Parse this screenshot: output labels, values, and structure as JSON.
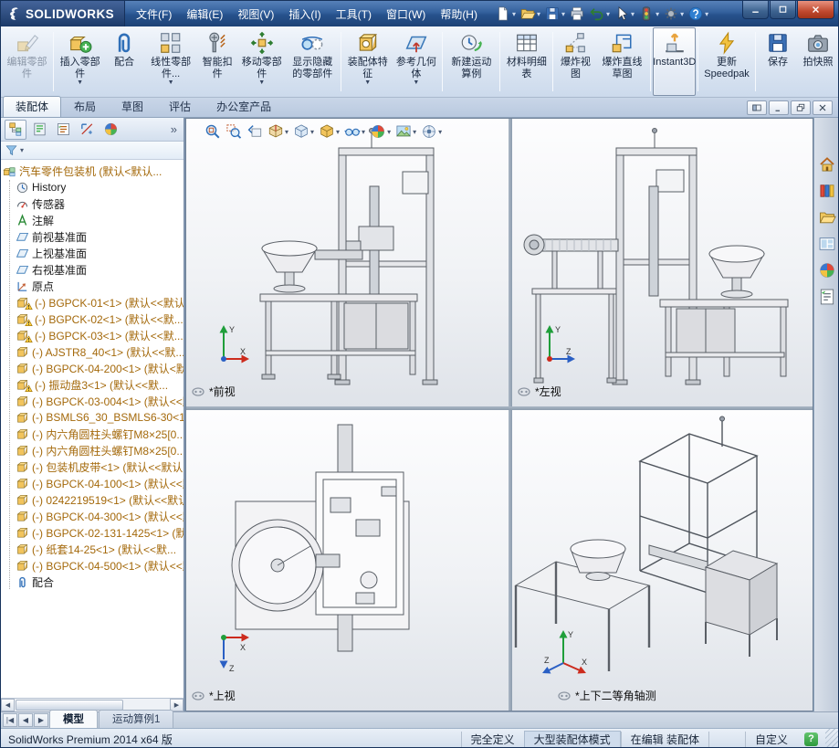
{
  "colors": {
    "titlebar_blue": "#2f5b99",
    "ribbon_background": "#d9e4f3",
    "component_text_orange": "#a4690b",
    "warning_yellow": "#ffd23e",
    "status_green": "#2e9a3c"
  },
  "titlebar": {
    "logo_text": "SOLIDWORKS",
    "menus": [
      "文件(F)",
      "编辑(E)",
      "视图(V)",
      "插入(I)",
      "工具(T)",
      "窗口(W)",
      "帮助(H)"
    ],
    "quick_access": [
      {
        "name": "new-document",
        "icon": "new-doc",
        "dropdown": true
      },
      {
        "name": "open-document",
        "icon": "open",
        "dropdown": true
      },
      {
        "name": "save-document",
        "icon": "save",
        "dropdown": true
      },
      {
        "name": "print-document",
        "icon": "print",
        "dropdown": false
      },
      {
        "name": "undo",
        "icon": "undo",
        "dropdown": true
      },
      {
        "name": "select-tool",
        "icon": "select-cursor",
        "dropdown": true
      },
      {
        "name": "rebuild",
        "icon": "rebuild",
        "dropdown": true
      },
      {
        "name": "options",
        "icon": "options",
        "dropdown": true
      },
      {
        "name": "help",
        "icon": "help",
        "dropdown": true
      }
    ],
    "window_buttons": [
      {
        "name": "minimize-window",
        "icon": "tb-min"
      },
      {
        "name": "maximize-window",
        "icon": "tb-max"
      },
      {
        "name": "close-window",
        "icon": "tb-close"
      }
    ]
  },
  "ribbon": {
    "buttons": [
      {
        "name": "edit-component-button",
        "icon": "edit-component",
        "label": "编辑零部件",
        "disabled": true,
        "sep": true
      },
      {
        "name": "insert-component-button",
        "icon": "insert-component",
        "label": "插入零部件",
        "dropdown": true
      },
      {
        "name": "mate-button",
        "icon": "mate",
        "label": "配合"
      },
      {
        "name": "linear-component-pattern-button",
        "icon": "linear-pattern",
        "label": "线性零部件...",
        "dropdown": true
      },
      {
        "name": "smart-fasteners-button",
        "icon": "smart-fastener",
        "label": "智能扣件"
      },
      {
        "name": "move-component-button",
        "icon": "move-component",
        "label": "移动零部件",
        "dropdown": true
      },
      {
        "name": "show-hidden-components-button",
        "icon": "show-hidden",
        "label": "显示隐藏的零部件",
        "sep": true
      },
      {
        "name": "assembly-features-button",
        "icon": "assembly-features",
        "label": "装配体特征",
        "dropdown": true
      },
      {
        "name": "reference-geometry-button",
        "icon": "reference-geometry",
        "label": "参考几何体",
        "dropdown": true,
        "sep": true
      },
      {
        "name": "new-motion-study-button",
        "icon": "motion-study",
        "label": "新建运动算例",
        "sep": true
      },
      {
        "name": "bill-of-materials-button",
        "icon": "bom",
        "label": "材料明细表",
        "sep": true
      },
      {
        "name": "exploded-view-button",
        "icon": "exploded-view",
        "label": "爆炸视图"
      },
      {
        "name": "explode-line-sketch-button",
        "icon": "explode-sketch",
        "label": "爆炸直线草图",
        "sep": true
      },
      {
        "name": "instant3d-button",
        "icon": "instant3d",
        "label": "Instant3D",
        "active": true,
        "sep": true
      },
      {
        "name": "update-speedpak-button",
        "icon": "speedpak",
        "label": "更新 Speedpak",
        "sep": true
      },
      {
        "name": "save-button",
        "icon": "save-small",
        "label": "保存"
      },
      {
        "name": "take-snapshot-button",
        "icon": "snapshot",
        "label": "拍快照"
      }
    ],
    "tabs": [
      {
        "label": "装配体",
        "active": true
      },
      {
        "label": "布局",
        "active": false
      },
      {
        "label": "草图",
        "active": false
      },
      {
        "label": "评估",
        "active": false
      },
      {
        "label": "办公室产品",
        "active": false
      }
    ]
  },
  "document_window_buttons": [
    {
      "name": "cascade-document-button",
      "icon": "win-prev"
    },
    {
      "name": "minimize-document-button",
      "icon": "win-min"
    },
    {
      "name": "restore-document-button",
      "icon": "win-restore"
    },
    {
      "name": "close-document-button",
      "icon": "win-close"
    }
  ],
  "feature_panel": {
    "overflow_chevron": "»",
    "tabs": [
      {
        "name": "featuremanager-tab",
        "icon": "fm-tree",
        "active": true
      },
      {
        "name": "propertymanager-tab",
        "icon": "pm",
        "active": false
      },
      {
        "name": "configurationmanager-tab",
        "icon": "cfg",
        "active": false
      },
      {
        "name": "dimxpertmanager-tab",
        "icon": "dim",
        "active": false
      },
      {
        "name": "displaymanager-tab",
        "icon": "disp",
        "active": false
      }
    ],
    "tree_items": [
      {
        "icon": "assembly",
        "label": "汽车零件包装机 (默认<默认...",
        "orange": true,
        "root": true
      },
      {
        "icon": "history",
        "label": "History"
      },
      {
        "icon": "sensor",
        "label": "传感器"
      },
      {
        "icon": "annotations",
        "label": "注解"
      },
      {
        "icon": "plane",
        "label": "前视基准面"
      },
      {
        "icon": "plane",
        "label": "上视基准面"
      },
      {
        "icon": "plane",
        "label": "右视基准面"
      },
      {
        "icon": "origin",
        "label": "原点"
      },
      {
        "icon": "part",
        "label": "(-) BGPCK-01<1> (默认<<默认...",
        "orange": true,
        "warning": true
      },
      {
        "icon": "part",
        "label": "(-) BGPCK-02<1> (默认<<默...",
        "orange": true,
        "warning": true
      },
      {
        "icon": "part",
        "label": "(-) BGPCK-03<1> (默认<<默...",
        "orange": true,
        "warning": true
      },
      {
        "icon": "part",
        "label": "(-) AJSTR8_40<1> (默认<<默...",
        "orange": true
      },
      {
        "icon": "part",
        "label": "(-) BGPCK-04-200<1> (默认<默...",
        "orange": true
      },
      {
        "icon": "part",
        "label": "(-) 振动盘3<1> (默认<<默...",
        "orange": true,
        "warning": true
      },
      {
        "icon": "part",
        "label": "(-) BGPCK-03-004<1> (默认<<默...",
        "orange": true
      },
      {
        "icon": "part",
        "label": "(-) BSMLS6_30_BSMLS6-30<1>...",
        "orange": true
      },
      {
        "icon": "part",
        "label": "(-) 内六角圆柱头螺钉M8×25[0...",
        "orange": true
      },
      {
        "icon": "part",
        "label": "(-) 内六角圆柱头螺钉M8×25[0...",
        "orange": true
      },
      {
        "icon": "part",
        "label": "(-) 包装机皮带<1> (默认<<默认...",
        "orange": true
      },
      {
        "icon": "part",
        "label": "(-) BGPCK-04-100<1> (默认<<默...",
        "orange": true
      },
      {
        "icon": "part",
        "label": "(-) 0242219519<1> (默认<<默认...",
        "orange": true
      },
      {
        "icon": "part",
        "label": "(-) BGPCK-04-300<1> (默认<<默...",
        "orange": true
      },
      {
        "icon": "part",
        "label": "(-) BGPCK-02-131-1425<1> (默...",
        "orange": true
      },
      {
        "icon": "part",
        "label": "(-) 纸套14-25<1> (默认<<默...",
        "orange": true
      },
      {
        "icon": "part",
        "label": "(-) BGPCK-04-500<1> (默认<<默...",
        "orange": true
      },
      {
        "icon": "mates",
        "label": "配合"
      }
    ]
  },
  "view_toolbar": [
    {
      "name": "zoom-to-fit-button",
      "icon": "zoom-fit",
      "dropdown": false
    },
    {
      "name": "zoom-to-area-button",
      "icon": "zoom-area",
      "dropdown": false
    },
    {
      "name": "previous-view-button",
      "icon": "previous-view",
      "dropdown": false
    },
    {
      "name": "section-view-button",
      "icon": "section-view",
      "dropdown": true
    },
    {
      "name": "view-orientation-button",
      "icon": "view-orientation",
      "dropdown": true
    },
    {
      "name": "display-style-button",
      "icon": "display-style",
      "dropdown": true
    },
    {
      "name": "hide-show-items-button",
      "icon": "hide-show-items",
      "dropdown": true
    },
    {
      "name": "edit-appearance-button",
      "icon": "edit-appearance",
      "dropdown": true
    },
    {
      "name": "apply-scene-button",
      "icon": "apply-scene",
      "dropdown": true
    },
    {
      "name": "view-settings-button",
      "icon": "view-settings",
      "dropdown": true
    }
  ],
  "viewports": {
    "front": {
      "label": "*前视"
    },
    "left": {
      "label": "*左视"
    },
    "top": {
      "label": "*上视"
    },
    "isometric": {
      "label": "*上下二等角轴测"
    }
  },
  "task_pane": [
    {
      "name": "solidworks-resources-tab",
      "icon": "sw-resources"
    },
    {
      "name": "design-library-tab",
      "icon": "design-library"
    },
    {
      "name": "file-explorer-tab",
      "icon": "file-explorer"
    },
    {
      "name": "view-palette-tab",
      "icon": "view-palette"
    },
    {
      "name": "appearances-scenes-tab",
      "icon": "appearances"
    },
    {
      "name": "custom-properties-tab",
      "icon": "custom-properties"
    }
  ],
  "model_tabs": {
    "nav": [
      "|◀",
      "◀",
      "▶"
    ],
    "tabs": [
      {
        "label": "模型",
        "active": true
      },
      {
        "label": "运动算例1",
        "active": false
      }
    ]
  },
  "statusbar": {
    "app_version": "SolidWorks Premium 2014 x64 版",
    "definition_state": "完全定义",
    "assembly_mode": "大型装配体模式",
    "editing_state": "在编辑 装配体",
    "customize": "自定义"
  }
}
